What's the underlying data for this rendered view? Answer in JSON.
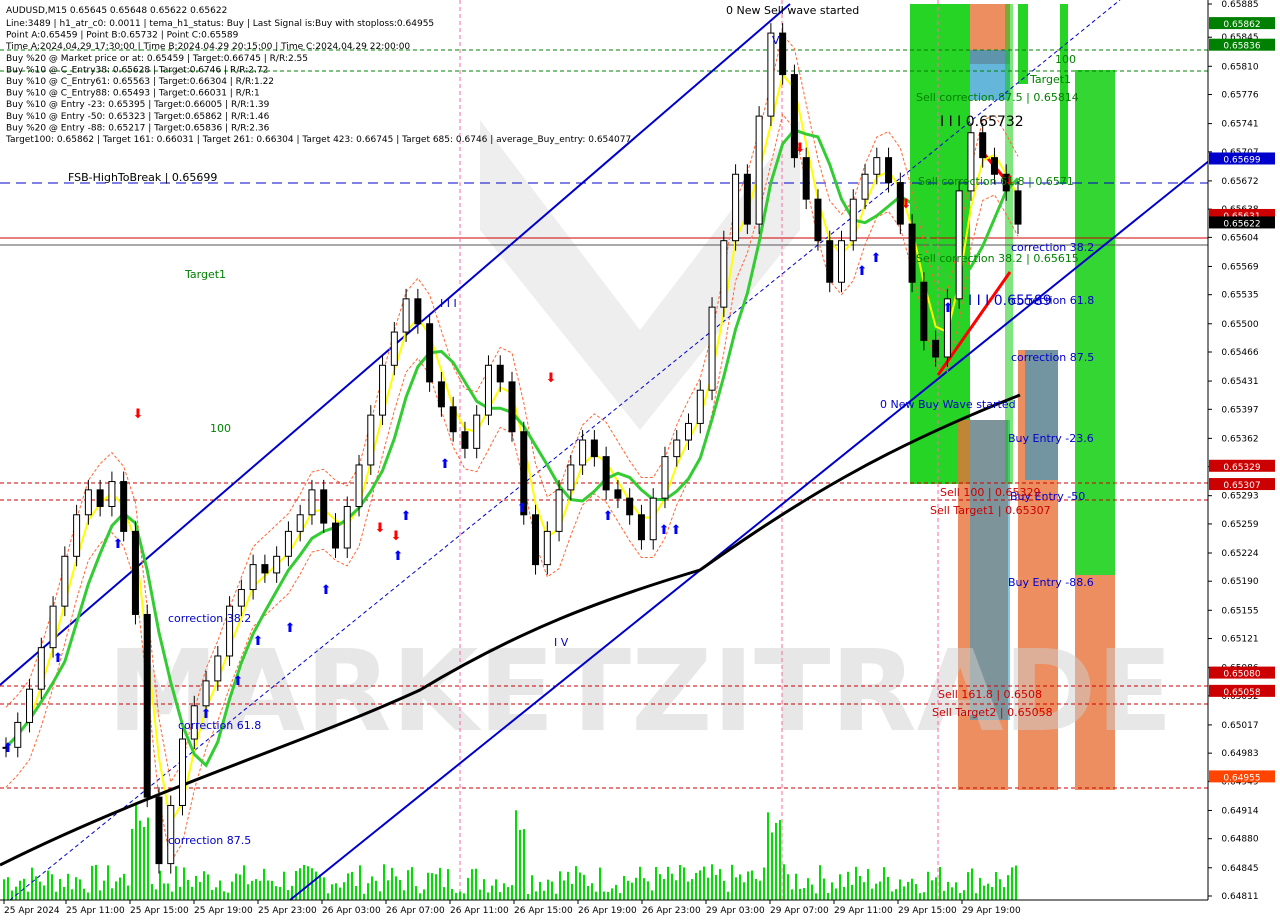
{
  "header": {
    "symbol_line": "AUDUSD,M15  0.65645 0.65648 0.65622 0.65622",
    "lines": [
      "Line:3489  |  h1_atr_c0: 0.0011  |  tema_h1_status: Buy  |  Last Signal is:Buy with stoploss:0.64955",
      "Point A:0.65459  |  Point B:0.65732  |  Point C:0.65589",
      "Time A:2024.04.29 17:30:00  |  Time B:2024.04.29 20:15:00  |  Time C:2024.04.29 22:00:00",
      "Buy %20 @ Market price or at: 0.65459  |  Target:0.66745  |  R/R:2.55",
      "Buy %10 @ C_Entry38: 0.65628  |  Target:0.6746  |  R/R:2.72",
      "Buy %10 @ C_Entry61: 0.65563  |  Target:0.66304  |  R/R:1.22",
      "Buy %10 @ C_Entry88: 0.65493  |  Target:0.66031  |  R/R:1",
      "Buy %10 @ Entry -23: 0.65395  |  Target:0.66005  |  R/R:1.39",
      "Buy %10 @ Entry -50: 0.65323  |  Target:0.65862  |  R/R:1.46",
      "Buy %20 @ Entry -88: 0.65217  |  Target:0.65836  |  R/R:2.36",
      "Target100: 0.65862  |  Target 161: 0.66031  |  Target 261: 0.66304  |  Target 423: 0.66745  |  Target 685: 0.6746  |  average_Buy_entry: 0.654077"
    ]
  },
  "colors": {
    "candle": "#000000",
    "ma_yellow": "#ffff00",
    "ma_green": "#33cc33",
    "ma_black": "#000000",
    "channel": "#0000cc",
    "buy_arrow": "#0000ff",
    "sell_arrow": "#ff0000",
    "green_zone": "#00cc00",
    "orange_zone": "#e8723a",
    "blue_zone": "#2299cc",
    "volume": "#00dd00"
  },
  "annotations": [
    {
      "text": "0 New Sell wave started",
      "color": "#000000"
    },
    {
      "text": "0 New Buy Wave started",
      "color": "#0000cc"
    },
    {
      "text": "FSB-HighToBreak  |  0.65699",
      "color": "#000000"
    },
    {
      "text": "Target1",
      "color": "#008000"
    },
    {
      "text": "Target1",
      "color": "#008000"
    },
    {
      "text": "100",
      "color": "#008000"
    },
    {
      "text": "100",
      "color": "#008000"
    },
    {
      "text": "Sell correction 87.5  |  0.65814",
      "color": "#008000"
    },
    {
      "text": "Sell correction 61.8  |  0.6571",
      "color": "#008000"
    },
    {
      "text": "Sell correction 38.2  |  0.65615",
      "color": "#008000"
    },
    {
      "text": "I  I  I  0.65732",
      "color": "#000000"
    },
    {
      "text": "I  I  I  0.65589",
      "color": "#0000cc"
    },
    {
      "text": "correction 38.2",
      "color": "#0000cc"
    },
    {
      "text": "correction 61.8",
      "color": "#0000cc"
    },
    {
      "text": "correction 87.5",
      "color": "#0000cc"
    },
    {
      "text": "Buy Entry -23.6",
      "color": "#0000cc"
    },
    {
      "text": "Buy Entry -50",
      "color": "#0000cc"
    },
    {
      "text": "Buy Entry -88.6",
      "color": "#0000cc"
    },
    {
      "text": "Sell 100  |  0.65329",
      "color": "#cc0000"
    },
    {
      "text": "Sell Target1  |  0.65307",
      "color": "#cc0000"
    },
    {
      "text": "Sell 161.8  |  0.6508",
      "color": "#cc0000"
    },
    {
      "text": "Sell Target2  |  0.65058",
      "color": "#cc0000"
    },
    {
      "text": "correction 38.2",
      "color": "#0000cc"
    },
    {
      "text": "correction 61.8",
      "color": "#0000cc"
    },
    {
      "text": "correction 87.5",
      "color": "#0000cc"
    },
    {
      "text": "I  I  I",
      "color": "#0000cc"
    },
    {
      "text": "I V",
      "color": "#0000cc"
    },
    {
      "text": "V",
      "color": "#0000cc"
    }
  ],
  "price_tags": [
    {
      "price": "0.65862",
      "bg": "#008000",
      "fg": "#ffffff"
    },
    {
      "price": "0.65836",
      "bg": "#008000",
      "fg": "#ffffff"
    },
    {
      "price": "0.65699",
      "bg": "#0000cc",
      "fg": "#ffffff"
    },
    {
      "price": "0.65631",
      "bg": "#cc0000",
      "fg": "#ffffff"
    },
    {
      "price": "0.65622",
      "bg": "#000000",
      "fg": "#ffffff"
    },
    {
      "price": "0.65329",
      "bg": "#cc0000",
      "fg": "#ffffff"
    },
    {
      "price": "0.65307",
      "bg": "#cc0000",
      "fg": "#ffffff"
    },
    {
      "price": "0.65080",
      "bg": "#cc0000",
      "fg": "#ffffff"
    },
    {
      "price": "0.65058",
      "bg": "#cc0000",
      "fg": "#ffffff"
    },
    {
      "price": "0.64955",
      "bg": "#ff4400",
      "fg": "#ffffff"
    }
  ],
  "watermark": "MARKETZITRADE",
  "chart_data": {
    "type": "candlestick",
    "title": "AUDUSD,M15",
    "y_ticks": [
      "0.65885",
      "0.65845",
      "0.65810",
      "0.65776",
      "0.65741",
      "0.65707",
      "0.65672",
      "0.65638",
      "0.65604",
      "0.65569",
      "0.65535",
      "0.65500",
      "0.65466",
      "0.65431",
      "0.65397",
      "0.65362",
      "0.65328",
      "0.65293",
      "0.65259",
      "0.65224",
      "0.65190",
      "0.65155",
      "0.65121",
      "0.65086",
      "0.65052",
      "0.65017",
      "0.64983",
      "0.64949",
      "0.64914",
      "0.64880",
      "0.64845",
      "0.64811"
    ],
    "ylim": [
      0.64811,
      0.65885
    ],
    "x_ticks": [
      "25 Apr 2024",
      "25 Apr 11:00",
      "25 Apr 15:00",
      "25 Apr 19:00",
      "25 Apr 23:00",
      "26 Apr 03:00",
      "26 Apr 07:00",
      "26 Apr 11:00",
      "26 Apr 15:00",
      "26 Apr 19:00",
      "26 Apr 23:00",
      "29 Apr 03:00",
      "29 Apr 07:00",
      "29 Apr 11:00",
      "29 Apr 15:00",
      "29 Apr 19:00"
    ],
    "close_series": [
      0.6499,
      0.6502,
      0.6506,
      0.6511,
      0.6516,
      0.6522,
      0.6527,
      0.653,
      0.6528,
      0.6531,
      0.6525,
      0.6515,
      0.6493,
      0.6485,
      0.6492,
      0.65,
      0.6504,
      0.6507,
      0.651,
      0.6516,
      0.6518,
      0.6521,
      0.652,
      0.6522,
      0.6525,
      0.6527,
      0.653,
      0.6526,
      0.6523,
      0.6528,
      0.6533,
      0.6539,
      0.6545,
      0.6549,
      0.6553,
      0.655,
      0.6543,
      0.654,
      0.6537,
      0.6535,
      0.6539,
      0.6545,
      0.6543,
      0.6537,
      0.6527,
      0.6521,
      0.6525,
      0.653,
      0.6533,
      0.6536,
      0.6534,
      0.653,
      0.6529,
      0.6527,
      0.6524,
      0.6529,
      0.6534,
      0.6536,
      0.6538,
      0.6542,
      0.6552,
      0.656,
      0.6568,
      0.6562,
      0.6575,
      0.6585,
      0.658,
      0.657,
      0.6565,
      0.656,
      0.6555,
      0.656,
      0.6565,
      0.6568,
      0.657,
      0.6567,
      0.6562,
      0.6555,
      0.6548,
      0.6546,
      0.6553,
      0.6566,
      0.6573,
      0.657,
      0.6568,
      0.6566,
      0.6562
    ],
    "series": []
  }
}
